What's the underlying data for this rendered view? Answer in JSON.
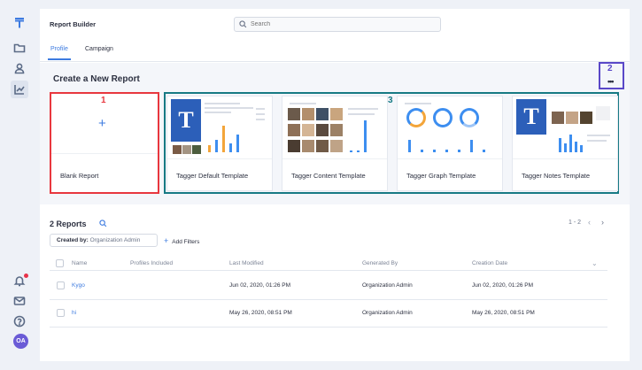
{
  "header": {
    "title": "Report Builder",
    "search_placeholder": "Search"
  },
  "tabs": [
    {
      "label": "Profile",
      "active": true
    },
    {
      "label": "Campaign",
      "active": false
    }
  ],
  "create_section": {
    "title": "Create a New Report",
    "more_annotation": "2",
    "more_icon": "more-horizontal-icon",
    "blank_card": {
      "annotation": "1",
      "label": "Blank Report",
      "icon": "plus-icon"
    },
    "templates_annotation": "3",
    "templates": [
      {
        "label": "Tagger Default Template"
      },
      {
        "label": "Tagger Content Template"
      },
      {
        "label": "Tagger Graph Template"
      },
      {
        "label": "Tagger Notes Template"
      }
    ]
  },
  "reports": {
    "count_label": "2 Reports",
    "pagination": "1 - 2",
    "filter_chip": {
      "key": "Created by:",
      "value": "Organization Admin"
    },
    "add_filters_label": "Add Filters",
    "columns": [
      "Name",
      "Profiles Included",
      "Last Modified",
      "Generated By",
      "Creation Date"
    ],
    "rows": [
      {
        "name": "Kygo",
        "profiles": "",
        "last_modified": "Jun 02, 2020, 01:26 PM",
        "generated_by": "Organization Admin",
        "creation_date": "Jun 02, 2020, 01:26 PM"
      },
      {
        "name": "hi",
        "profiles": "",
        "last_modified": "May 26, 2020, 08:51 PM",
        "generated_by": "Organization Admin",
        "creation_date": "May 26, 2020, 08:51 PM"
      }
    ]
  },
  "sidebar": {
    "items": [
      "logo-icon",
      "folder-icon",
      "user-icon",
      "chart-icon"
    ],
    "bottom": [
      "bell-icon",
      "mail-icon",
      "help-icon"
    ],
    "avatar_initials": "OA"
  },
  "colors": {
    "accent": "#3d7be0",
    "annotation_red": "#e8373e",
    "annotation_purple": "#5a48c8",
    "annotation_teal": "#177a84",
    "avatar": "#6a5bd6"
  }
}
